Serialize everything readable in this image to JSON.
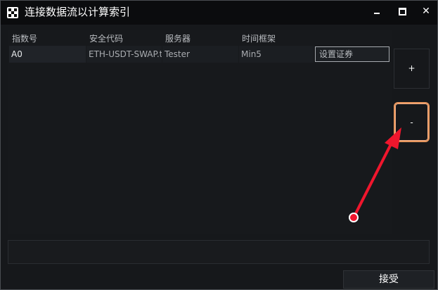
{
  "window": {
    "title": "连接数据流以计算索引",
    "controls": {
      "minimize_icon": "minimize-icon",
      "maximize_icon": "maximize-icon",
      "close_label": "✕"
    }
  },
  "table": {
    "headers": [
      "指数号",
      "安全代码",
      "服务器",
      "时间框架"
    ],
    "rows": [
      {
        "index": "A0",
        "security_code": "ETH-USDT-SWAP.t",
        "server": "Tester",
        "timeframe": "Min5",
        "set_security_label": "设置证券"
      }
    ]
  },
  "side_buttons": {
    "add_label": "+",
    "remove_label": "-"
  },
  "footer": {
    "accept_label": "接受"
  },
  "annotation": {
    "arrow_color": "#f0162d",
    "highlight_color": "#e8975e"
  }
}
